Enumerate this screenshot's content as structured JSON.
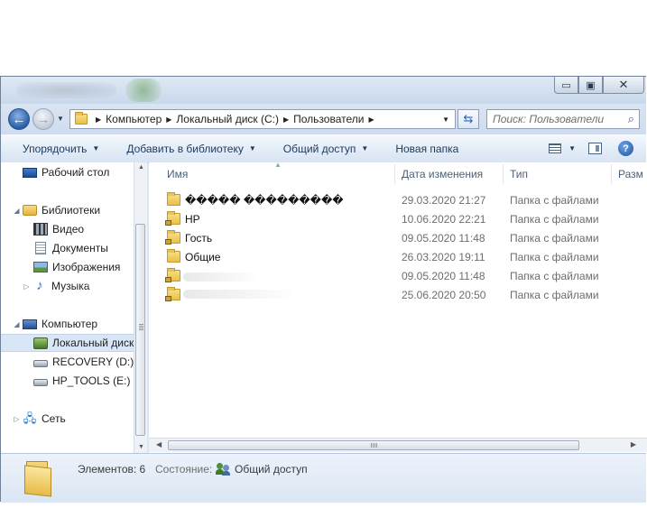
{
  "window": {
    "caption_buttons": {
      "minimize": "▭",
      "maximize": "▣",
      "close": "✕"
    }
  },
  "address_bar": {
    "breadcrumbs": [
      "Компьютер",
      "Локальный диск (C:)",
      "Пользователи"
    ],
    "search_placeholder": "Поиск: Пользователи"
  },
  "toolbar": {
    "organize": "Упорядочить",
    "add_to_library": "Добавить в библиотеку",
    "share": "Общий доступ",
    "new_folder": "Новая папка"
  },
  "nav_pane": {
    "desktop": "Рабочий стол",
    "libraries": "Библиотеки",
    "video": "Видео",
    "documents": "Документы",
    "pictures": "Изображения",
    "music": "Музыка",
    "computer": "Компьютер",
    "local_disk": "Локальный диск",
    "recovery": "RECOVERY (D:)",
    "hp_tools": "HP_TOOLS (E:)",
    "network": "Сеть"
  },
  "columns": {
    "name": "Имя",
    "date": "Дата изменения",
    "type": "Тип",
    "size": "Разм"
  },
  "files": [
    {
      "name": "����� ���������",
      "date": "29.03.2020 21:27",
      "type": "Папка с файлами",
      "locked": false
    },
    {
      "name": "HP",
      "date": "10.06.2020 22:21",
      "type": "Папка с файлами",
      "locked": true
    },
    {
      "name": "Гость",
      "date": "09.05.2020 11:48",
      "type": "Папка с файлами",
      "locked": true
    },
    {
      "name": "Общие",
      "date": "26.03.2020 19:11",
      "type": "Папка с файлами",
      "locked": false
    },
    {
      "name": "",
      "date": "09.05.2020 11:48",
      "type": "Папка с файлами",
      "locked": true
    },
    {
      "name": "",
      "date": "25.06.2020 20:50",
      "type": "Папка с файлами",
      "locked": true
    }
  ],
  "details": {
    "count": "Элементов: 6",
    "state_label": "Состояние:",
    "state_value": "Общий доступ"
  }
}
